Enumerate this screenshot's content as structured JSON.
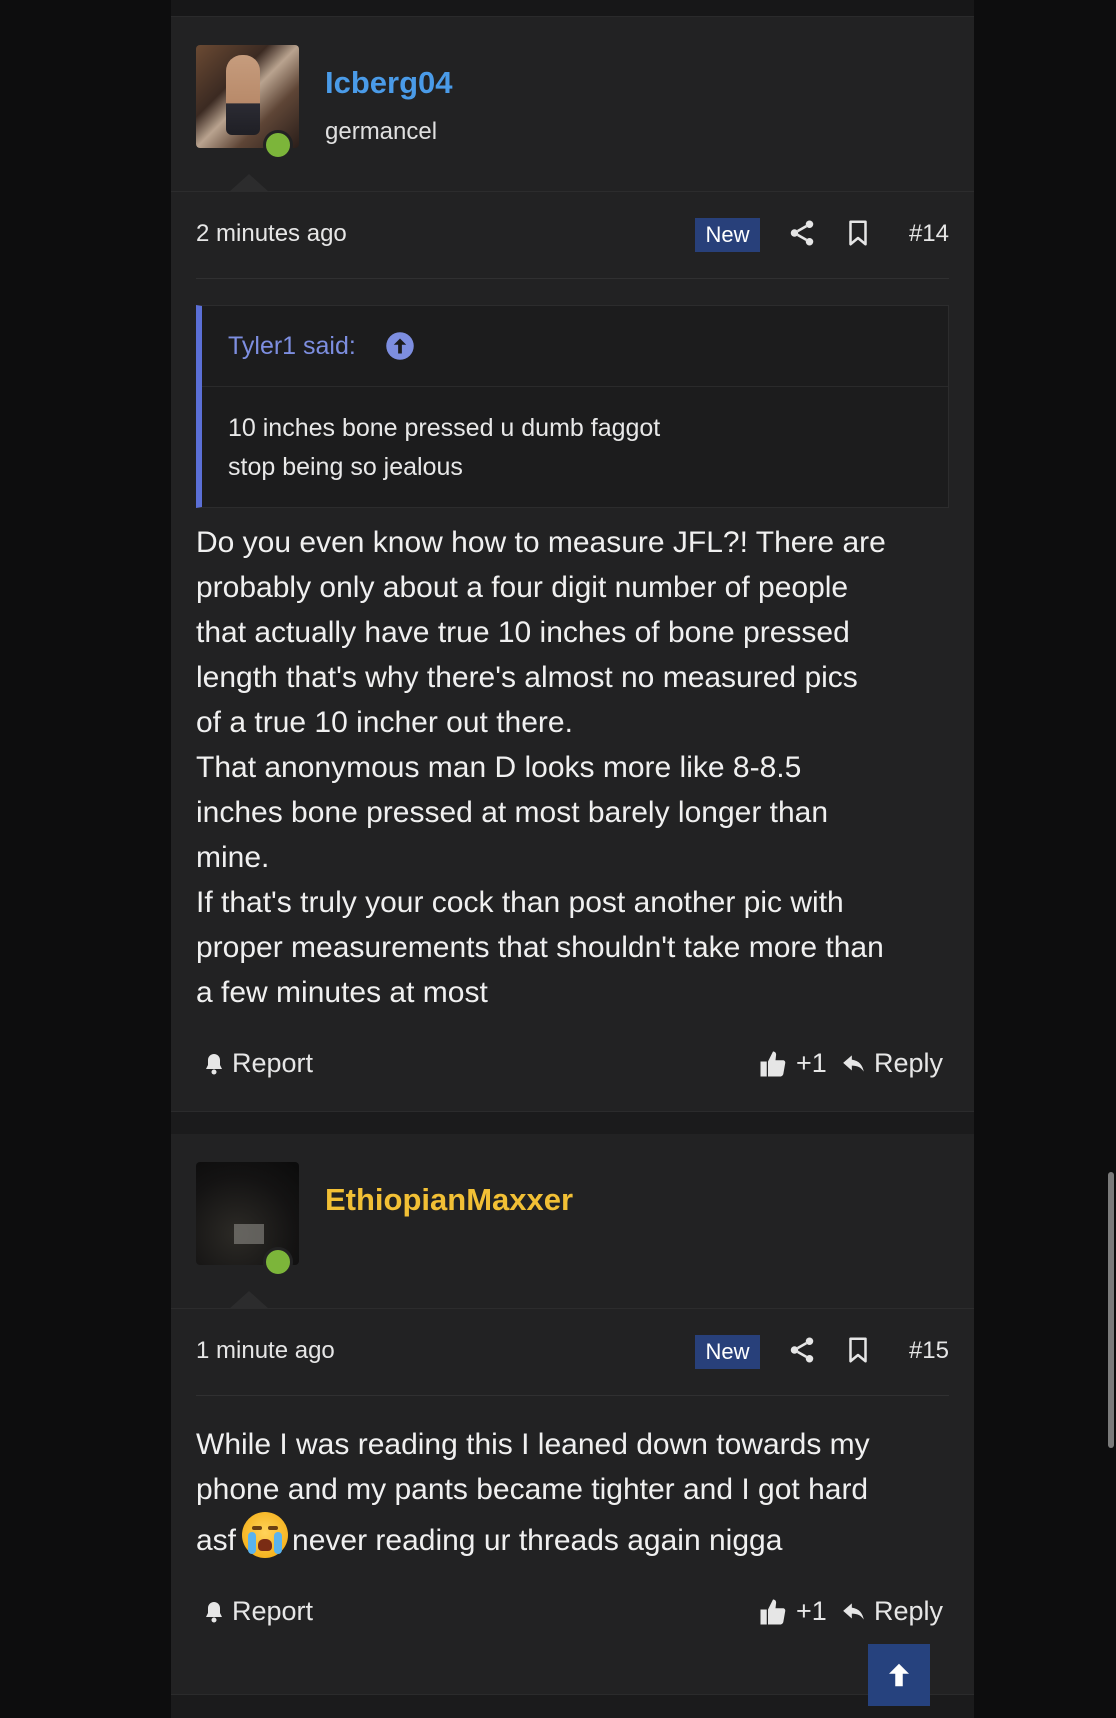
{
  "colors": {
    "accent": "#28407a",
    "username_1": "#4a9be8",
    "username_2": "#f2c035",
    "online": "#7cb53a",
    "quote_bar": "#5b6fd6"
  },
  "posts": [
    {
      "username": "Icberg04",
      "user_title": "germancel",
      "timestamp": "2 minutes ago",
      "badge": "New",
      "number": "#14",
      "quote": {
        "author": "Tyler1 said:",
        "lines": [
          "10 inches bone pressed u dumb faggot",
          "stop being so jealous"
        ]
      },
      "message_lines": [
        "Do you even know how to measure JFL?! There are",
        "probably only about a four digit number of people",
        "that actually have true 10 inches of bone pressed",
        "length that's why there's almost no measured pics",
        "of a true 10 incher out there.",
        "That anonymous man D looks more like 8-8.5",
        "inches bone pressed at most barely longer than",
        "mine.",
        "If that's truly your cock than post another pic with",
        "proper measurements that shouldn't take more than",
        "a few minutes at most"
      ],
      "report_label": "Report",
      "like_count": "+1",
      "reply_label": "Reply"
    },
    {
      "username": "EthiopianMaxxer",
      "user_title": "",
      "timestamp": "1 minute ago",
      "badge": "New",
      "number": "#15",
      "message_lines": [
        "While I was reading this I leaned down towards my",
        "phone and my pants became tighter and I got hard"
      ],
      "message_line3_before": "asf",
      "message_emoji": "loudly-crying-face",
      "message_line3_after": "never reading ur threads again nigga",
      "report_label": "Report",
      "like_count": "+1",
      "reply_label": "Reply"
    }
  ],
  "icons": {
    "share": "share-icon",
    "bookmark": "bookmark-icon",
    "quote_jump": "arrow-up-circle-icon",
    "report": "bell-icon",
    "like": "thumbs-up-icon",
    "reply": "reply-arrow-icon",
    "scroll_top": "arrow-up-icon"
  }
}
